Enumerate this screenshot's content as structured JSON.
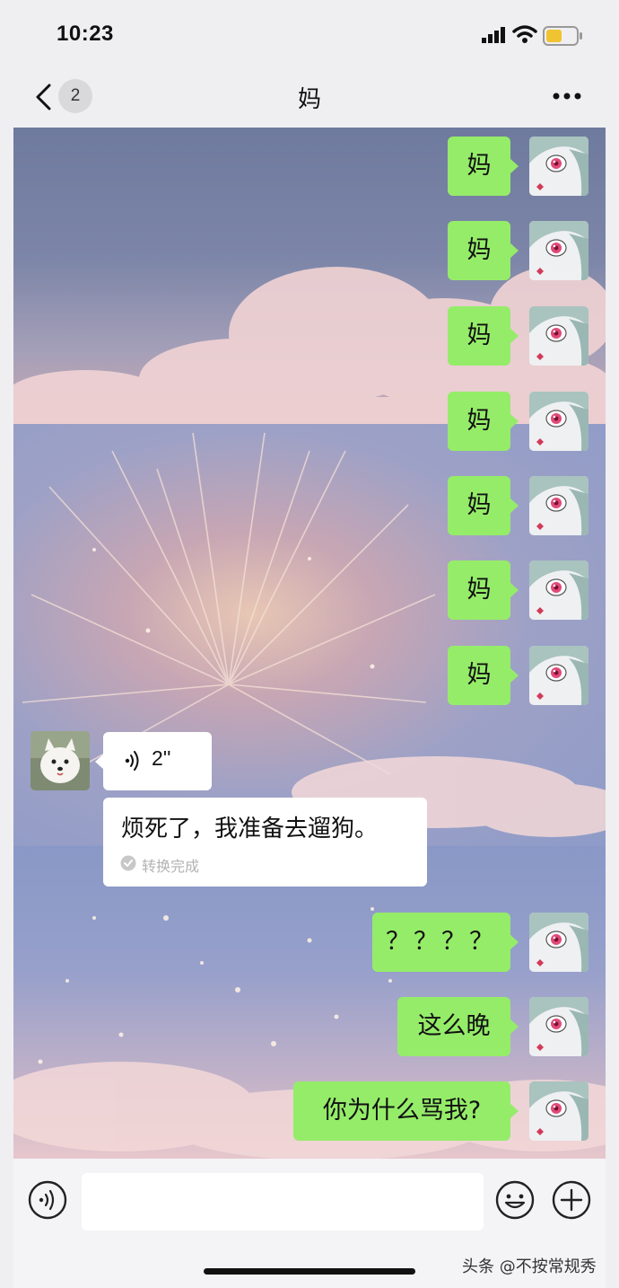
{
  "status_bar": {
    "time": "10:23"
  },
  "nav": {
    "unread_count": "2",
    "title": "妈"
  },
  "messages_sent_top": [
    "妈",
    "妈",
    "妈",
    "妈",
    "妈",
    "妈",
    "妈"
  ],
  "voice_message": {
    "duration": "2''",
    "transcript": "烦死了，我准备去遛狗。",
    "status": "转换完成"
  },
  "messages_sent_bottom": [
    "？？？？",
    "这么晚",
    "你为什么骂我?"
  ],
  "input": {
    "placeholder": ""
  },
  "watermark": "头条 @不按常规秀",
  "colors": {
    "sent_bubble": "#95ec69",
    "received_bubble": "#ffffff"
  },
  "icons": [
    "back-icon",
    "more-icon",
    "voice-wave-icon",
    "check-circle-icon",
    "voice-toggle-icon",
    "emoji-icon",
    "plus-icon"
  ]
}
